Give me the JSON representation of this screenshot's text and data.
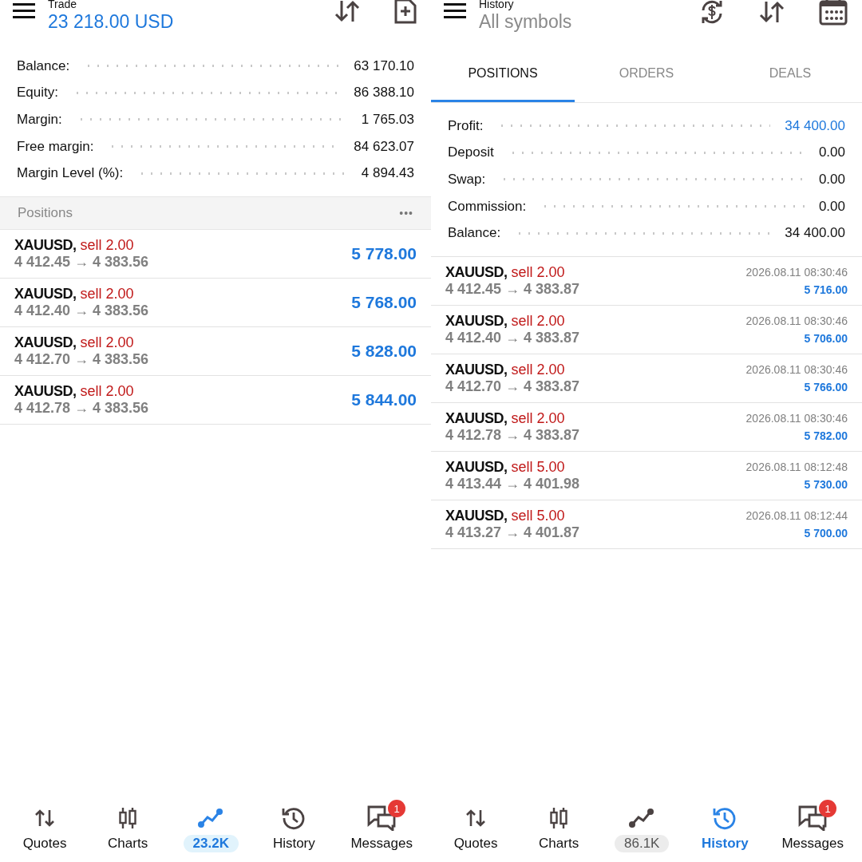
{
  "trade_screen": {
    "header": {
      "title": "Trade",
      "subtitle": "23 218.00 USD"
    },
    "summary": [
      {
        "label": "Balance:",
        "value": "63 170.10"
      },
      {
        "label": "Equity:",
        "value": "86 388.10"
      },
      {
        "label": "Margin:",
        "value": "1 765.03"
      },
      {
        "label": "Free margin:",
        "value": "84 623.07"
      },
      {
        "label": "Margin Level (%):",
        "value": "4 894.43"
      }
    ],
    "section": {
      "title": "Positions",
      "more": "•••"
    },
    "positions": [
      {
        "symbol": "XAUUSD,",
        "side": "sell 2.00",
        "prices": "4 412.45 → 4 383.56",
        "profit": "5 778.00"
      },
      {
        "symbol": "XAUUSD,",
        "side": "sell 2.00",
        "prices": "4 412.40 → 4 383.56",
        "profit": "5 768.00"
      },
      {
        "symbol": "XAUUSD,",
        "side": "sell 2.00",
        "prices": "4 412.70 → 4 383.56",
        "profit": "5 828.00"
      },
      {
        "symbol": "XAUUSD,",
        "side": "sell 2.00",
        "prices": "4 412.78 → 4 383.56",
        "profit": "5 844.00"
      }
    ],
    "nav": [
      {
        "kind": "quotes",
        "label": "Quotes",
        "selected": false
      },
      {
        "kind": "charts",
        "label": "Charts",
        "selected": false
      },
      {
        "kind": "trade",
        "label": "23.2K",
        "selected": true
      },
      {
        "kind": "history",
        "label": "History",
        "selected": false
      },
      {
        "kind": "messages",
        "label": "Messages",
        "selected": false,
        "badge": "1"
      }
    ]
  },
  "history_screen": {
    "header": {
      "title": "History",
      "subtitle": "All symbols"
    },
    "tabs": [
      {
        "label": "POSITIONS",
        "selected": true
      },
      {
        "label": "ORDERS",
        "selected": false
      },
      {
        "label": "DEALS",
        "selected": false
      }
    ],
    "summary": [
      {
        "label": "Profit:",
        "value": "34 400.00",
        "highlight": true
      },
      {
        "label": "Deposit",
        "value": "0.00",
        "highlight": false
      },
      {
        "label": "Swap:",
        "value": "0.00",
        "highlight": false
      },
      {
        "label": "Commission:",
        "value": "0.00",
        "highlight": false
      },
      {
        "label": "Balance:",
        "value": "34 400.00",
        "highlight": false
      }
    ],
    "positions": [
      {
        "symbol": "XAUUSD,",
        "side": "sell 2.00",
        "prices": "4 412.45 → 4 383.87",
        "time": "2026.08.11 08:30:46",
        "profit": "5 716.00"
      },
      {
        "symbol": "XAUUSD,",
        "side": "sell 2.00",
        "prices": "4 412.40 → 4 383.87",
        "time": "2026.08.11 08:30:46",
        "profit": "5 706.00"
      },
      {
        "symbol": "XAUUSD,",
        "side": "sell 2.00",
        "prices": "4 412.70 → 4 383.87",
        "time": "2026.08.11 08:30:46",
        "profit": "5 766.00"
      },
      {
        "symbol": "XAUUSD,",
        "side": "sell 2.00",
        "prices": "4 412.78 → 4 383.87",
        "time": "2026.08.11 08:30:46",
        "profit": "5 782.00"
      },
      {
        "symbol": "XAUUSD,",
        "side": "sell 5.00",
        "prices": "4 413.44 → 4 401.98",
        "time": "2026.08.11 08:12:48",
        "profit": "5 730.00"
      },
      {
        "symbol": "XAUUSD,",
        "side": "sell 5.00",
        "prices": "4 413.27 → 4 401.87",
        "time": "2026.08.11 08:12:44",
        "profit": "5 700.00"
      }
    ],
    "nav": [
      {
        "kind": "quotes",
        "label": "Quotes",
        "selected": false
      },
      {
        "kind": "charts",
        "label": "Charts",
        "selected": false
      },
      {
        "kind": "trade",
        "label": "86.1K",
        "selected": false
      },
      {
        "kind": "history",
        "label": "History",
        "selected": true
      },
      {
        "kind": "messages",
        "label": "Messages",
        "selected": false,
        "badge": "1"
      }
    ]
  }
}
